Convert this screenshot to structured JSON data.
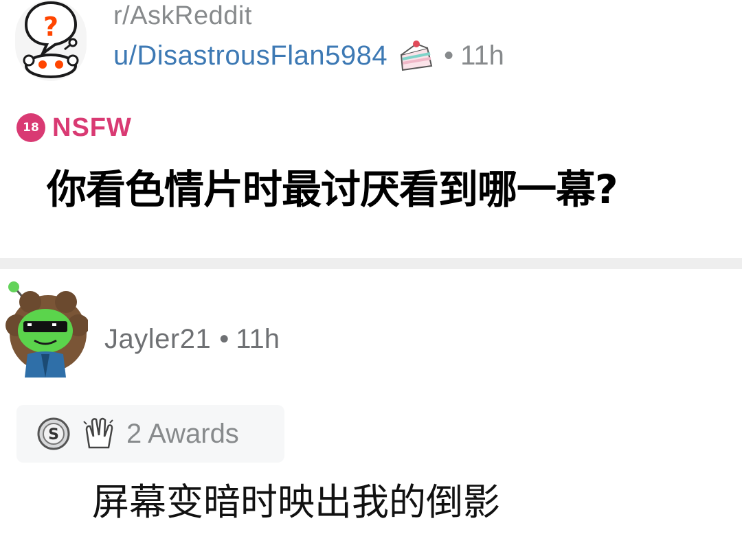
{
  "post": {
    "subreddit": "r/AskReddit",
    "author": "u/DisastrousFlan5984",
    "separator": "•",
    "time": "11h",
    "nsfw_badge": "18",
    "nsfw_label": "NSFW",
    "title": "你看色情片时最讨厌看到哪一幕?",
    "icons": {
      "subreddit_avatar": "askreddit-snoo-icon",
      "author_flair": "cake-icon"
    }
  },
  "comment": {
    "author": "Jayler21",
    "separator": "•",
    "time": "11h",
    "awards_label": "2 Awards",
    "body": "屏幕变暗时映出我的倒影",
    "icons": {
      "avatar": "green-snoo-avatar-icon",
      "awards": [
        "silver-award-icon",
        "clapping-hands-award-icon"
      ]
    }
  },
  "colors": {
    "meta_gray": "#878a8c",
    "author_blue": "#3d79b4",
    "nsfw_pink": "#d93a73",
    "divider": "#eeeeee"
  }
}
